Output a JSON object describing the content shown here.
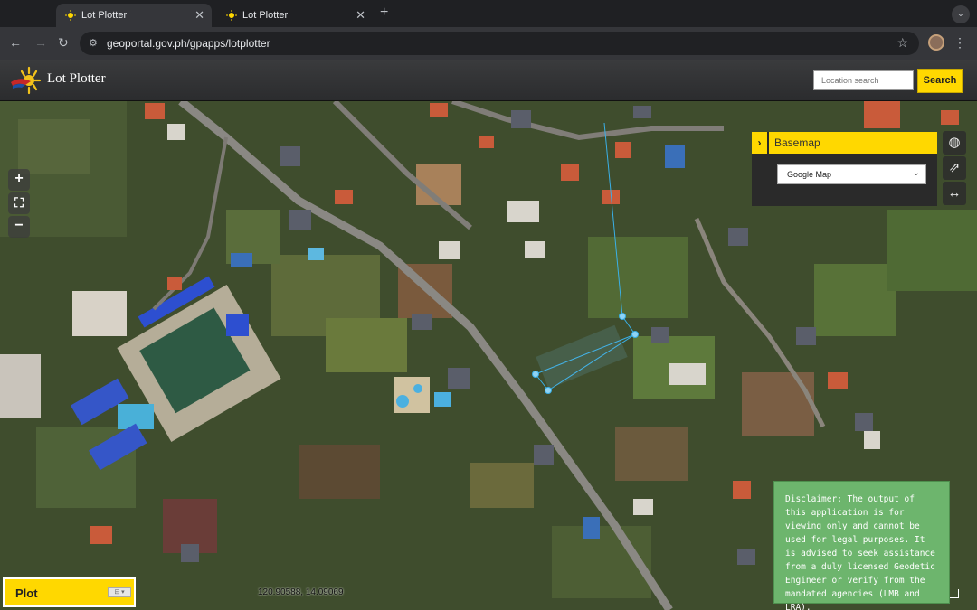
{
  "browser": {
    "tabs": [
      {
        "title": "Lot Plotter",
        "active": true
      },
      {
        "title": "Lot Plotter",
        "active": false
      }
    ],
    "url": "geoportal.gov.ph/gpapps/lotplotter"
  },
  "app": {
    "title": "Lot Plotter",
    "location_search_placeholder": "Location search",
    "search_label": "Search",
    "accent_color": "#ffd800"
  },
  "map": {
    "zoom_in": "+",
    "zoom_out": "−",
    "fullscreen": "⛶",
    "basemap": {
      "title": "Basemap",
      "selected": "Google Map"
    },
    "tools": [
      "globe-icon",
      "export-icon",
      "measure-icon"
    ],
    "disclaimer": "Disclaimer: The output of this application is for viewing only and cannot be used for legal purposes. It is advised to seek assistance from a duly licensed Geodetic Engineer or verify from the mandated agencies (LMB and LRA).",
    "plot_label": "Plot",
    "coordinates": "120.90588, 14.09069"
  }
}
